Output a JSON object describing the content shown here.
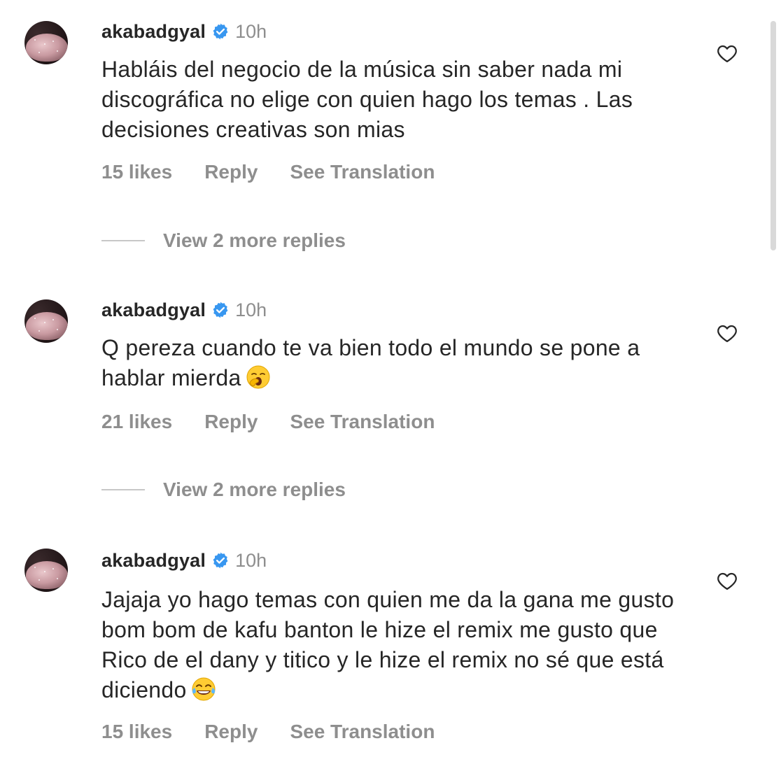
{
  "comments": [
    {
      "username": "akabadgyal",
      "time": "10h",
      "text": "Habláis del negocio de la música sin saber nada mi discográfica no elige con quien hago los temas . Las decisiones creativas son mias",
      "emoji": "",
      "likes": "15 likes",
      "reply_label": "Reply",
      "translate_label": "See Translation",
      "more_replies": "View 2 more replies"
    },
    {
      "username": "akabadgyal",
      "time": "10h",
      "text": "Q pereza cuando te va bien todo el mundo se pone a hablar mierda",
      "emoji": "yawning-face-icon",
      "likes": "21 likes",
      "reply_label": "Reply",
      "translate_label": "See Translation",
      "more_replies": "View 2 more replies"
    },
    {
      "username": "akabadgyal",
      "time": "10h",
      "text": "Jajaja yo hago temas con quien me da la gana me gusto bom bom de kafu banton le hize el remix me gusto que Rico de el dany y titico y le hize el remix no sé que está diciendo",
      "emoji": "face-with-tears-of-joy-icon",
      "likes": "15 likes",
      "reply_label": "Reply",
      "translate_label": "See Translation"
    }
  ],
  "colors": {
    "text": "#262626",
    "secondary": "#8e8e8e",
    "verified": "#3897f0"
  }
}
